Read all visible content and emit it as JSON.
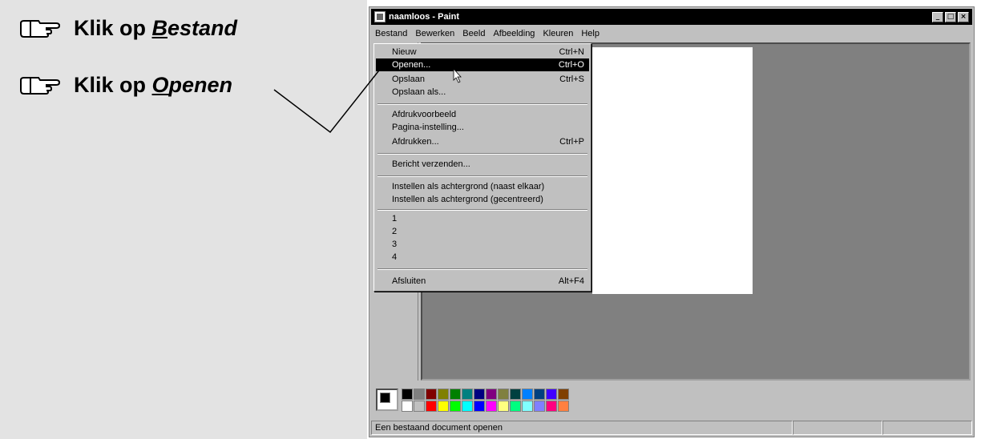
{
  "instructions": [
    {
      "prefix": "Klik op ",
      "key_letter": "B",
      "rest": "estand"
    },
    {
      "prefix": "Klik op ",
      "key_letter": "O",
      "rest": "penen"
    }
  ],
  "window": {
    "title": "naamloos - Paint",
    "btn_min": "_",
    "btn_max": "□",
    "btn_close": "×"
  },
  "menubar": [
    "Bestand",
    "Bewerken",
    "Beeld",
    "Afbeelding",
    "Kleuren",
    "Help"
  ],
  "menu": {
    "items": [
      {
        "label": "Nieuw",
        "shortcut": "Ctrl+N"
      },
      {
        "label": "Openen...",
        "shortcut": "Ctrl+O"
      },
      {
        "label": "Opslaan",
        "shortcut": "Ctrl+S"
      },
      {
        "label": "Opslaan als...",
        "shortcut": ""
      },
      {
        "label": "Afdrukvoorbeeld",
        "shortcut": ""
      },
      {
        "label": "Pagina-instelling...",
        "shortcut": ""
      },
      {
        "label": "Afdrukken...",
        "shortcut": "Ctrl+P"
      },
      {
        "label": "Bericht verzenden...",
        "shortcut": ""
      },
      {
        "label": "Instellen als achtergrond (naast elkaar)",
        "shortcut": ""
      },
      {
        "label": "Instellen als achtergrond (gecentreerd)",
        "shortcut": ""
      },
      {
        "label": "1",
        "shortcut": ""
      },
      {
        "label": "2",
        "shortcut": ""
      },
      {
        "label": "3",
        "shortcut": ""
      },
      {
        "label": "4",
        "shortcut": ""
      },
      {
        "label": "Afsluiten",
        "shortcut": "Alt+F4"
      }
    ]
  },
  "status": {
    "text": "Een bestaand document openen"
  },
  "palette": {
    "colors": [
      "#000000",
      "#808080",
      "#800000",
      "#808000",
      "#008000",
      "#008080",
      "#000080",
      "#800080",
      "#808040",
      "#004040",
      "#0080ff",
      "#004080",
      "#4000ff",
      "#804000",
      "#ffffff",
      "#c0c0c0",
      "#ff0000",
      "#ffff00",
      "#00ff00",
      "#00ffff",
      "#0000ff",
      "#ff00ff",
      "#ffff80",
      "#00ff80",
      "#80ffff",
      "#8080ff",
      "#ff0080",
      "#ff8040"
    ]
  }
}
